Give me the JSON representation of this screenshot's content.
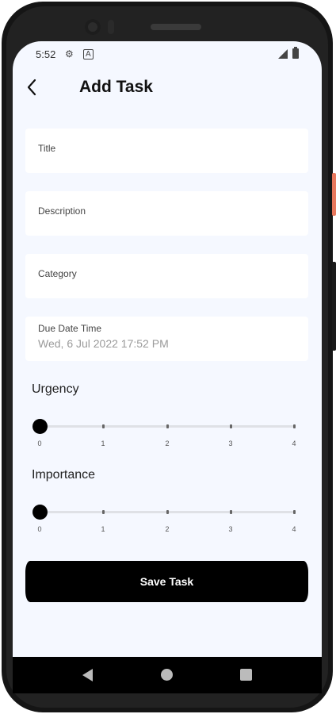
{
  "status_bar": {
    "time": "5:52",
    "icons": [
      "gear-icon",
      "notification-a-icon",
      "signal-icon",
      "battery-icon"
    ]
  },
  "app_bar": {
    "title": "Add Task",
    "back_icon": "arrow-back-icon"
  },
  "form": {
    "title_placeholder": "Title",
    "description_placeholder": "Description",
    "category_placeholder": "Category",
    "due_label": "Due Date Time",
    "due_value": "Wed, 6 Jul 2022 17:52 PM"
  },
  "urgency": {
    "label": "Urgency",
    "value": 0,
    "ticks": [
      "0",
      "1",
      "2",
      "3",
      "4"
    ]
  },
  "importance": {
    "label": "Importance",
    "value": 0,
    "ticks": [
      "0",
      "1",
      "2",
      "3",
      "4"
    ]
  },
  "save_button": "Save Task",
  "colors": {
    "screen_bg": "#f5f8ff",
    "button_bg": "#000000",
    "accent_side_button": "#e8775c"
  }
}
